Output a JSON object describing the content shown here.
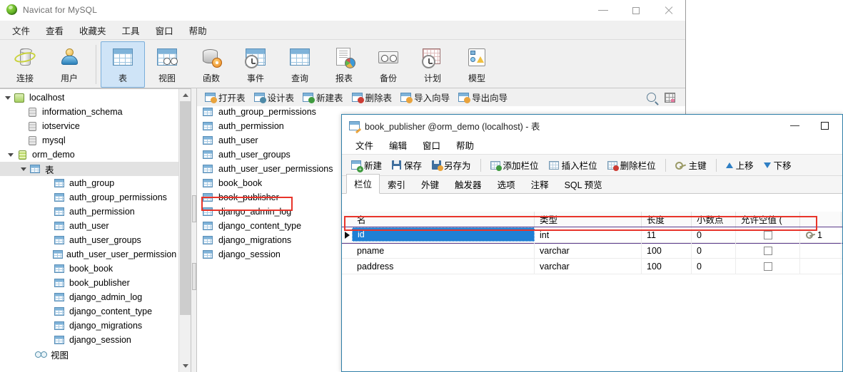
{
  "main_window": {
    "title": "Navicat for MySQL",
    "app_icon": "navicat-icon",
    "controls": {
      "minimize": "minimize",
      "maximize": "maximize",
      "close": "close"
    },
    "menubar": [
      "文件",
      "查看",
      "收藏夹",
      "工具",
      "窗口",
      "帮助"
    ],
    "toolbar": [
      {
        "label": "连接",
        "icon": "connection-icon",
        "active": false
      },
      {
        "label": "用户",
        "icon": "user-icon",
        "active": false
      },
      {
        "label": "表",
        "icon": "table-icon",
        "active": true
      },
      {
        "label": "视图",
        "icon": "view-icon",
        "active": false
      },
      {
        "label": "函数",
        "icon": "function-icon",
        "active": false
      },
      {
        "label": "事件",
        "icon": "event-icon",
        "active": false
      },
      {
        "label": "查询",
        "icon": "query-icon",
        "active": false
      },
      {
        "label": "报表",
        "icon": "report-icon",
        "active": false
      },
      {
        "label": "备份",
        "icon": "backup-icon",
        "active": false
      },
      {
        "label": "计划",
        "icon": "schedule-icon",
        "active": false
      },
      {
        "label": "模型",
        "icon": "model-icon",
        "active": false
      }
    ],
    "connection_bar_label": "连接"
  },
  "tree": {
    "nodes": [
      {
        "label": "localhost",
        "icon": "server-icon",
        "depth": 0,
        "expanded": true,
        "selected": false
      },
      {
        "label": "information_schema",
        "icon": "database-icon",
        "depth": 1,
        "expanded": null,
        "selected": false
      },
      {
        "label": "iotservice",
        "icon": "database-icon",
        "depth": 1,
        "expanded": null,
        "selected": false
      },
      {
        "label": "mysql",
        "icon": "database-icon",
        "depth": 1,
        "expanded": null,
        "selected": false
      },
      {
        "label": "orm_demo",
        "icon": "database-active-icon",
        "depth": 1,
        "expanded": true,
        "selected": false
      },
      {
        "label": "表",
        "icon": "table-icon",
        "depth": 2,
        "expanded": true,
        "selected": true
      },
      {
        "label": "auth_group",
        "icon": "table-icon",
        "depth": 3,
        "expanded": null,
        "selected": false
      },
      {
        "label": "auth_group_permissions",
        "icon": "table-icon",
        "depth": 3,
        "expanded": null,
        "selected": false
      },
      {
        "label": "auth_permission",
        "icon": "table-icon",
        "depth": 3,
        "expanded": null,
        "selected": false
      },
      {
        "label": "auth_user",
        "icon": "table-icon",
        "depth": 3,
        "expanded": null,
        "selected": false
      },
      {
        "label": "auth_user_groups",
        "icon": "table-icon",
        "depth": 3,
        "expanded": null,
        "selected": false
      },
      {
        "label": "auth_user_user_permission",
        "icon": "table-icon",
        "depth": 3,
        "expanded": null,
        "selected": false
      },
      {
        "label": "book_book",
        "icon": "table-icon",
        "depth": 3,
        "expanded": null,
        "selected": false
      },
      {
        "label": "book_publisher",
        "icon": "table-icon",
        "depth": 3,
        "expanded": null,
        "selected": false
      },
      {
        "label": "django_admin_log",
        "icon": "table-icon",
        "depth": 3,
        "expanded": null,
        "selected": false
      },
      {
        "label": "django_content_type",
        "icon": "table-icon",
        "depth": 3,
        "expanded": null,
        "selected": false
      },
      {
        "label": "django_migrations",
        "icon": "table-icon",
        "depth": 3,
        "expanded": null,
        "selected": false
      },
      {
        "label": "django_session",
        "icon": "table-icon",
        "depth": 3,
        "expanded": null,
        "selected": false
      },
      {
        "label": "视图",
        "icon": "view-icon",
        "depth": 2,
        "expanded": null,
        "selected": false
      }
    ]
  },
  "object_pane": {
    "toolbar": [
      {
        "label": "打开表",
        "icon": "open-table-icon"
      },
      {
        "label": "设计表",
        "icon": "design-table-icon"
      },
      {
        "label": "新建表",
        "icon": "new-table-icon"
      },
      {
        "label": "删除表",
        "icon": "delete-table-icon"
      },
      {
        "label": "导入向导",
        "icon": "import-wizard-icon"
      },
      {
        "label": "导出向导",
        "icon": "export-wizard-icon"
      }
    ],
    "right_tools": [
      {
        "icon": "search-icon"
      },
      {
        "icon": "grid-view-icon"
      }
    ],
    "items": [
      {
        "label": "auth_group",
        "highlighted": false
      },
      {
        "label": "auth_group_permissions",
        "highlighted": false
      },
      {
        "label": "auth_permission",
        "highlighted": false
      },
      {
        "label": "auth_user",
        "highlighted": false
      },
      {
        "label": "auth_user_groups",
        "highlighted": false
      },
      {
        "label": "auth_user_user_permissions",
        "highlighted": false
      },
      {
        "label": "book_book",
        "highlighted": false
      },
      {
        "label": "book_publisher",
        "highlighted": true
      },
      {
        "label": "django_admin_log",
        "highlighted": false
      },
      {
        "label": "django_content_type",
        "highlighted": false
      },
      {
        "label": "django_migrations",
        "highlighted": false
      },
      {
        "label": "django_session",
        "highlighted": false
      }
    ]
  },
  "child_window": {
    "title": "book_publisher @orm_demo (localhost) - 表",
    "icon": "design-table-icon",
    "controls": {
      "minimize": "minimize",
      "maximize": "maximize"
    },
    "menubar": [
      "文件",
      "编辑",
      "窗口",
      "帮助"
    ],
    "toolbar": [
      {
        "label": "新建",
        "icon": "new-icon"
      },
      {
        "label": "保存",
        "icon": "save-icon"
      },
      {
        "label": "另存为",
        "icon": "save-as-icon"
      },
      {
        "label": "添加栏位",
        "icon": "add-field-icon"
      },
      {
        "label": "插入栏位",
        "icon": "insert-field-icon"
      },
      {
        "label": "删除栏位",
        "icon": "delete-field-icon"
      },
      {
        "label": "主键",
        "icon": "primary-key-icon"
      },
      {
        "label": "上移",
        "icon": "move-up-icon"
      },
      {
        "label": "下移",
        "icon": "move-down-icon"
      }
    ],
    "tabs": [
      {
        "label": "栏位",
        "active": true
      },
      {
        "label": "索引",
        "active": false
      },
      {
        "label": "外键",
        "active": false
      },
      {
        "label": "触发器",
        "active": false
      },
      {
        "label": "选项",
        "active": false
      },
      {
        "label": "注释",
        "active": false
      },
      {
        "label": "SQL 预览",
        "active": false
      }
    ],
    "grid": {
      "headers": [
        "名",
        "类型",
        "长度",
        "小数点",
        "允许空值 ("
      ],
      "rows": [
        {
          "name": "id",
          "type": "int",
          "length": "11",
          "decimals": "0",
          "nullable": false,
          "key": "1",
          "selected": true
        },
        {
          "name": "pname",
          "type": "varchar",
          "length": "100",
          "decimals": "0",
          "nullable": false,
          "key": "",
          "selected": false
        },
        {
          "name": "paddress",
          "type": "varchar",
          "length": "100",
          "decimals": "0",
          "nullable": false,
          "key": "",
          "selected": false
        }
      ]
    }
  },
  "annotations": {
    "accent_color": "#e8342a",
    "boxes": [
      {
        "target": "book_publisher-list-item"
      },
      {
        "target": "id-grid-row"
      }
    ]
  }
}
